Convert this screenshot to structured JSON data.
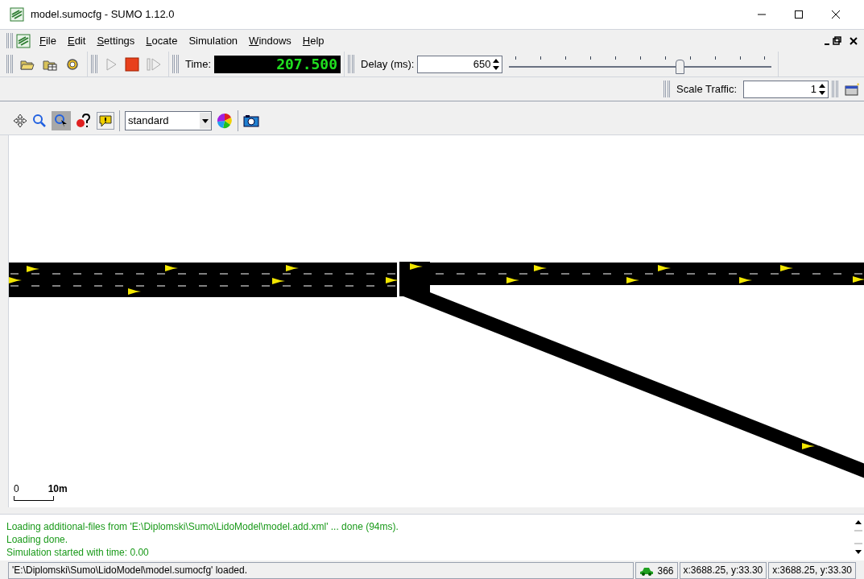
{
  "window": {
    "title": "model.sumocfg - SUMO 1.12.0"
  },
  "menu": [
    {
      "label": "File",
      "mnemonic": true
    },
    {
      "label": "Edit",
      "mnemonic": true
    },
    {
      "label": "Settings",
      "mnemonic": true
    },
    {
      "label": "Locate",
      "mnemonic": true
    },
    {
      "label": "Simulation",
      "mnemonic": false
    },
    {
      "label": "Windows",
      "mnemonic": true
    },
    {
      "label": "Help",
      "mnemonic": true
    }
  ],
  "toolbar": {
    "time_label": "Time:",
    "time_value": "207.500",
    "delay_label": "Delay (ms):",
    "delay_value": "650",
    "delay_slider": {
      "level": 0.65
    },
    "run_enabled": false,
    "step_enabled": false
  },
  "scale_traffic": {
    "label": "Scale Traffic:",
    "value": "1"
  },
  "view_toolbar": {
    "locate_selected": true,
    "scheme": "standard"
  },
  "canvas": {
    "scale_start": "0",
    "scale_end": "10m"
  },
  "messages": [
    {
      "text": "Loading additional-files from 'E:\\Diplomski\\Sumo\\LidoModel\\model.add.xml' ... done (94ms)."
    },
    {
      "text": "Loading done."
    },
    {
      "text": "Simulation started with time: 0.00"
    }
  ],
  "status_bar": {
    "message": "'E:\\Diplomski\\Sumo\\LidoModel\\model.sumocfg' loaded.",
    "vehicles": "366",
    "coords": [
      "x:3688.25, y:33.30",
      "x:3688.25, y:33.30"
    ]
  }
}
